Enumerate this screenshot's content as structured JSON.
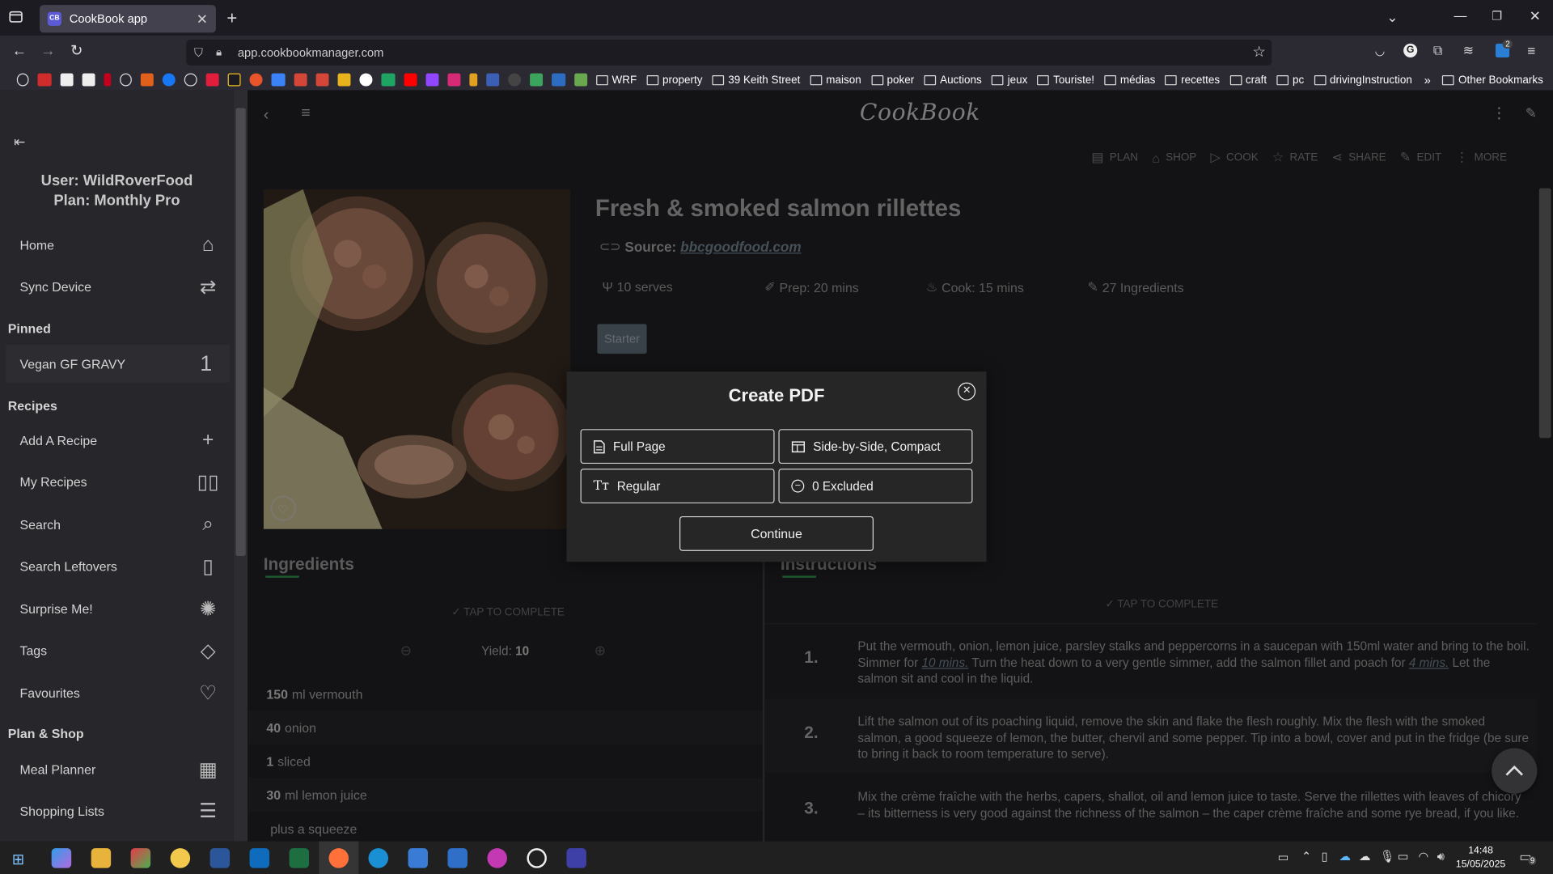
{
  "browser": {
    "tab_title": "CookBook app",
    "tab_favicon": "CB",
    "url": "app.cookbookmanager.com",
    "bookmarks": [
      "WRF",
      "property",
      "39 Keith Street",
      "maison",
      "poker",
      "Auctions",
      "jeux",
      "Touriste!",
      "médias",
      "recettes",
      "craft",
      "pc",
      "drivingInstruction"
    ],
    "other_bookmarks": "Other Bookmarks",
    "extension_badge": "2"
  },
  "sidebar": {
    "user_line": "User: WildRoverFood",
    "plan_line": "Plan: Monthly Pro",
    "top_items": [
      {
        "label": "Home",
        "icon": "home-icon"
      },
      {
        "label": "Sync Device",
        "icon": "sync-icon"
      }
    ],
    "pinned_heading": "Pinned",
    "pinned_item": {
      "label": "Vegan GF GRAVY",
      "badge": "1"
    },
    "recipes_heading": "Recipes",
    "recipe_items": [
      {
        "label": "Add A Recipe",
        "icon": "plus-icon"
      },
      {
        "label": "My Recipes",
        "icon": "book-icon"
      },
      {
        "label": "Search",
        "icon": "search-icon"
      },
      {
        "label": "Search Leftovers",
        "icon": "fridge-icon"
      },
      {
        "label": "Surprise Me!",
        "icon": "lightbulb-icon"
      },
      {
        "label": "Tags",
        "icon": "tags-icon"
      },
      {
        "label": "Favourites",
        "icon": "heart-icon"
      }
    ],
    "plan_heading": "Plan & Shop",
    "plan_items": [
      {
        "label": "Meal Planner",
        "icon": "calendar-icon"
      },
      {
        "label": "Shopping Lists",
        "icon": "checklist-icon"
      }
    ]
  },
  "header": {
    "logo": "CookBook"
  },
  "actions": [
    "PLAN",
    "SHOP",
    "COOK",
    "RATE",
    "SHARE",
    "EDIT",
    "MORE"
  ],
  "recipe": {
    "title": "Fresh & smoked salmon rillettes",
    "source_label": "Source:",
    "source_link": "bbcgoodfood.com",
    "serves": "10 serves",
    "prep": "Prep: 20 mins",
    "cook": "Cook: 15 mins",
    "ingredients_count": "27 Ingredients",
    "tag": "Starter"
  },
  "ingredients": {
    "heading": "Ingredients",
    "tap": "TAP TO COMPLETE",
    "yield_label": "Yield:",
    "yield_value": "10",
    "items": [
      {
        "qty": "150",
        "text": "ml vermouth"
      },
      {
        "qty": "40",
        "text": "onion"
      },
      {
        "qty": "1",
        "text": "sliced"
      },
      {
        "qty": "30",
        "text": "ml lemon juice"
      },
      {
        "qty": "",
        "text": "plus a squeeze"
      }
    ]
  },
  "instructions": {
    "heading": "Instructions",
    "tap": "TAP TO COMPLETE",
    "steps": [
      {
        "num": "1.",
        "a": "Put the vermouth, onion, lemon juice, parsley stalks and peppercorns in a saucepan with 150ml water and bring to the boil. Simmer for ",
        "l1": "10 mins.",
        "b": " Turn the heat down to a very gentle simmer, add the salmon fillet and poach for ",
        "l2": "4 mins.",
        "c": " Let the salmon sit and cool in the liquid."
      },
      {
        "num": "2.",
        "a": "Lift the salmon out of its poaching liquid, remove the skin and flake the flesh roughly. Mix the flesh with the smoked salmon, a good squeeze of lemon, the butter, chervil and some pepper. Tip into a bowl, cover and put in the fridge (be sure to bring it back to room temperature to serve)."
      },
      {
        "num": "3.",
        "a": "Mix the crème fraîche with the herbs, capers, shallot, oil and lemon juice to taste. Serve the rillettes with leaves of chicory – its bitterness is very good against the richness of the salmon – the caper crème fraîche and some rye bread, if you like."
      }
    ]
  },
  "modal": {
    "title": "Create PDF",
    "page_option": "Full Page",
    "layout_option": "Side-by-Side, Compact",
    "font_option": "Regular",
    "excluded_option": "0 Excluded",
    "continue": "Continue"
  },
  "taskbar": {
    "time": "14:48",
    "date": "15/05/2025",
    "notifications": "9"
  }
}
